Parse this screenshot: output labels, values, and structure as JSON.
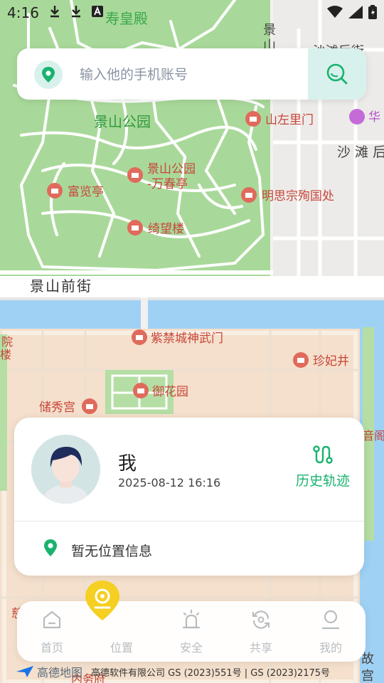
{
  "status_bar": {
    "time": "4:16"
  },
  "search": {
    "placeholder": "输入他的手机账号"
  },
  "map": {
    "labels": {
      "shouhuangdian": "寿皇殿",
      "jingshan_park": "景山公园",
      "shanzuolimen": "山左里门",
      "wanchunting": "景山公园",
      "wanchunting2": "-万春亭",
      "fulanting": "富览亭",
      "mingsizong": "明思宗殉国处",
      "qiwanglou": "绮望楼",
      "jingshan_qianjie": "景山前街",
      "shenwumen": "紫禁城神武门",
      "zhenfeijing": "珍妃井",
      "yuhuayuan": "御花园",
      "chuxiugong": "储秀宫",
      "shatanhou": "沙 滩 后",
      "shatanbei": "沙滩后街",
      "jing": "景",
      "shan": "山",
      "yuan": "院",
      "lou": "楼",
      "hua": "华",
      "gong": "宫",
      "gu": "故",
      "ci": "慈",
      "yinge": "音阁",
      "zhongyongfu": "内务府"
    }
  },
  "card": {
    "name": "我",
    "time": "2025-08-12 16:16",
    "history_label": "历史轨迹",
    "location_text": "暂无位置信息"
  },
  "tabs": [
    {
      "label": "首页",
      "icon": "home-icon"
    },
    {
      "label": "位置",
      "icon": "location-pin-icon"
    },
    {
      "label": "安全",
      "icon": "alarm-icon"
    },
    {
      "label": "共享",
      "icon": "share-refresh-icon"
    },
    {
      "label": "我的",
      "icon": "profile-icon"
    }
  ],
  "footer": {
    "logo_text": "高德地图",
    "copyright": "高德软件有限公司  GS (2023)551号 | GS (2023)2175号"
  },
  "colors": {
    "accent": "#19b36e",
    "active_tab": "#f5cf22",
    "park_green": "#a9d99a",
    "water": "#9fd1f5"
  }
}
